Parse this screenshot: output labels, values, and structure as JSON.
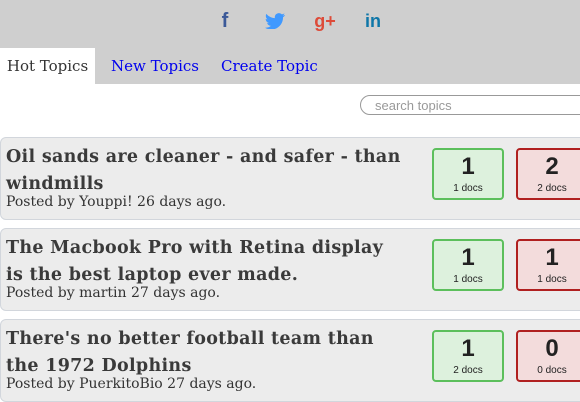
{
  "social": [
    {
      "icon": "facebook-icon",
      "glyph": "f",
      "color": "#3b5998"
    },
    {
      "icon": "twitter-icon",
      "color": "#4099ff"
    },
    {
      "icon": "google-plus-icon",
      "glyph": "g+",
      "color": "#dd4b39"
    },
    {
      "icon": "linkedin-icon",
      "glyph": "in",
      "color": "#0e76a8"
    }
  ],
  "tabs": [
    {
      "label": "Hot Topics",
      "active": true
    },
    {
      "label": "New Topics",
      "active": false
    },
    {
      "label": "Create Topic",
      "active": false
    }
  ],
  "search": {
    "placeholder": "search topics",
    "value": ""
  },
  "topics": [
    {
      "title_line1": "Oil sands are cleaner - and safer - than",
      "title_line2": "windmills",
      "meta": "Posted by Youppi! 26 days ago.",
      "for": {
        "count": "1",
        "docs": "1 docs"
      },
      "against": {
        "count": "2",
        "docs": "2 docs"
      }
    },
    {
      "title_line1": "The Macbook Pro with Retina display",
      "title_line2": "is the best laptop ever made.",
      "meta": "Posted by martin 27 days ago.",
      "for": {
        "count": "1",
        "docs": "1 docs"
      },
      "against": {
        "count": "1",
        "docs": "1 docs"
      }
    },
    {
      "title_line1": "There's no better football team than",
      "title_line2": "the 1972 Dolphins",
      "meta": "Posted by PuerkitoBio 27 days ago.",
      "for": {
        "count": "1",
        "docs": "2 docs"
      },
      "against": {
        "count": "0",
        "docs": "0 docs"
      }
    }
  ],
  "colors": {
    "header_bg": "#cfcfcf",
    "link": "#0000ee",
    "card_bg": "#ececec",
    "green_border": "#5cbf5c",
    "green_bg": "#ddf1dd",
    "red_border": "#b02020",
    "red_bg": "#f3dcdc"
  }
}
